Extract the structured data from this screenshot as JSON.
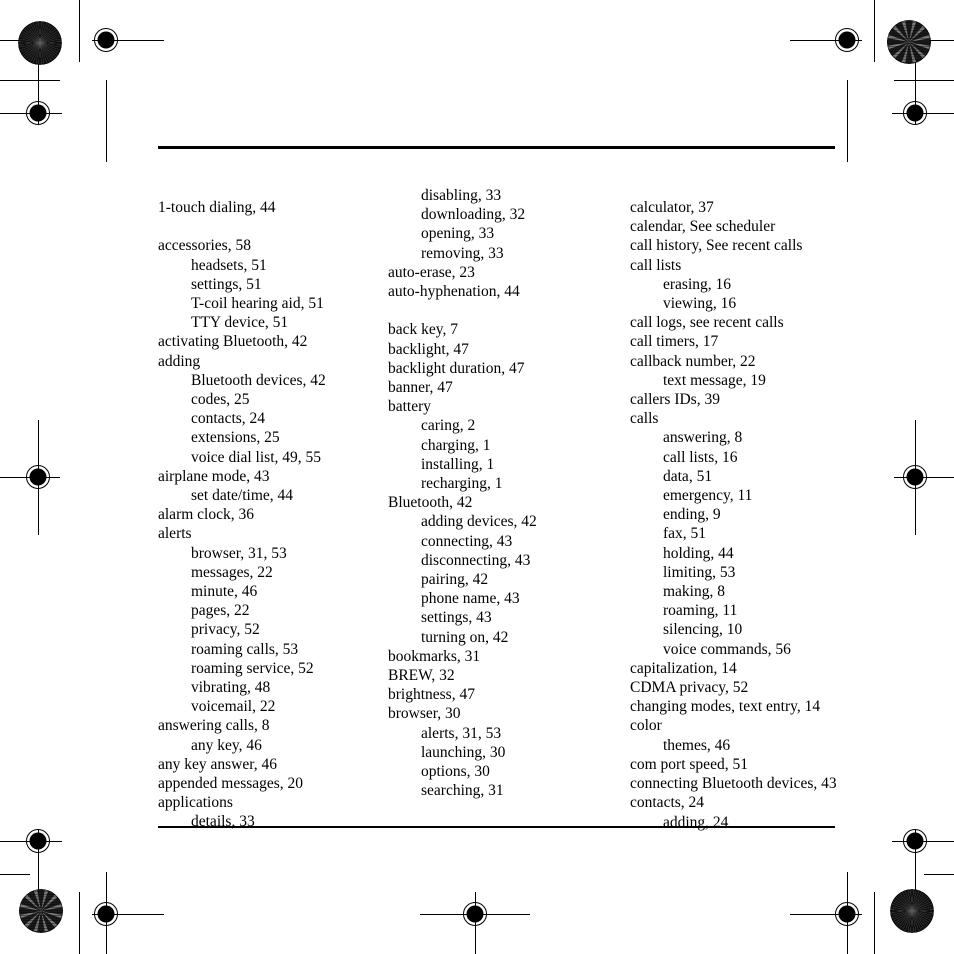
{
  "page": {
    "kind": "printed-index-page",
    "ink_color": "#000000",
    "paper_color": "#ffffff"
  },
  "rules": {
    "top_rule_label": "top-horizontal-rule",
    "bottom_rule_label": "bottom-horizontal-rule"
  },
  "printer_marks": {
    "registration_target_name": "registration-target",
    "star_target_name": "star-resolution-target",
    "crop_mark_name": "crop-mark"
  },
  "columns": [
    {
      "name": "index-column-1",
      "entries": [
        {
          "level": 1,
          "text": "1-touch dialing, 44"
        },
        {
          "level": 0,
          "text": ""
        },
        {
          "level": 1,
          "text": "accessories, 58"
        },
        {
          "level": 2,
          "text": "headsets, 51"
        },
        {
          "level": 2,
          "text": "settings, 51"
        },
        {
          "level": 2,
          "text": "T-coil hearing aid, 51"
        },
        {
          "level": 2,
          "text": "TTY device, 51"
        },
        {
          "level": 1,
          "text": "activating Bluetooth, 42"
        },
        {
          "level": 1,
          "text": "adding"
        },
        {
          "level": 2,
          "text": "Bluetooth devices, 42"
        },
        {
          "level": 2,
          "text": "codes, 25"
        },
        {
          "level": 2,
          "text": "contacts, 24"
        },
        {
          "level": 2,
          "text": "extensions, 25"
        },
        {
          "level": 2,
          "text": "voice dial list, 49, 55"
        },
        {
          "level": 1,
          "text": "airplane mode, 43"
        },
        {
          "level": 2,
          "text": "set date/time, 44"
        },
        {
          "level": 1,
          "text": "alarm clock, 36"
        },
        {
          "level": 1,
          "text": "alerts"
        },
        {
          "level": 2,
          "text": "browser, 31, 53"
        },
        {
          "level": 2,
          "text": "messages, 22"
        },
        {
          "level": 2,
          "text": "minute, 46"
        },
        {
          "level": 2,
          "text": "pages, 22"
        },
        {
          "level": 2,
          "text": "privacy, 52"
        },
        {
          "level": 2,
          "text": "roaming calls, 53"
        },
        {
          "level": 2,
          "text": "roaming service, 52"
        },
        {
          "level": 2,
          "text": "vibrating, 48"
        },
        {
          "level": 2,
          "text": "voicemail, 22"
        },
        {
          "level": 1,
          "text": "answering calls, 8"
        },
        {
          "level": 2,
          "text": "any key, 46"
        },
        {
          "level": 1,
          "text": "any key answer, 46"
        },
        {
          "level": 1,
          "text": "appended messages, 20"
        },
        {
          "level": 1,
          "text": "applications"
        },
        {
          "level": 2,
          "text": "details, 33"
        }
      ]
    },
    {
      "name": "index-column-2",
      "entries": [
        {
          "level": 2,
          "text": "disabling, 33"
        },
        {
          "level": 2,
          "text": "downloading, 32"
        },
        {
          "level": 2,
          "text": "opening, 33"
        },
        {
          "level": 2,
          "text": "removing, 33"
        },
        {
          "level": 1,
          "text": "auto-erase, 23"
        },
        {
          "level": 1,
          "text": "auto-hyphenation, 44"
        },
        {
          "level": 0,
          "text": ""
        },
        {
          "level": 1,
          "text": "back key, 7"
        },
        {
          "level": 1,
          "text": "backlight, 47"
        },
        {
          "level": 1,
          "text": "backlight duration, 47"
        },
        {
          "level": 1,
          "text": "banner, 47"
        },
        {
          "level": 1,
          "text": "battery"
        },
        {
          "level": 2,
          "text": "caring, 2"
        },
        {
          "level": 2,
          "text": "charging, 1"
        },
        {
          "level": 2,
          "text": "installing, 1"
        },
        {
          "level": 2,
          "text": "recharging, 1"
        },
        {
          "level": 1,
          "text": "Bluetooth, 42"
        },
        {
          "level": 2,
          "text": "adding devices, 42"
        },
        {
          "level": 2,
          "text": "connecting, 43"
        },
        {
          "level": 2,
          "text": "disconnecting, 43"
        },
        {
          "level": 2,
          "text": "pairing, 42"
        },
        {
          "level": 2,
          "text": "phone name, 43"
        },
        {
          "level": 2,
          "text": "settings, 43"
        },
        {
          "level": 2,
          "text": "turning on, 42"
        },
        {
          "level": 1,
          "text": "bookmarks, 31"
        },
        {
          "level": 1,
          "text": "BREW, 32"
        },
        {
          "level": 1,
          "text": "brightness, 47"
        },
        {
          "level": 1,
          "text": "browser, 30"
        },
        {
          "level": 2,
          "text": "alerts, 31, 53"
        },
        {
          "level": 2,
          "text": "launching, 30"
        },
        {
          "level": 2,
          "text": "options, 30"
        },
        {
          "level": 2,
          "text": "searching, 31"
        }
      ]
    },
    {
      "name": "index-column-3",
      "entries": [
        {
          "level": 1,
          "text": "calculator, 37"
        },
        {
          "level": 1,
          "text": "calendar, See scheduler"
        },
        {
          "level": 1,
          "text": "call history, See recent calls"
        },
        {
          "level": 1,
          "text": "call lists"
        },
        {
          "level": 2,
          "text": "erasing, 16"
        },
        {
          "level": 2,
          "text": "viewing, 16"
        },
        {
          "level": 1,
          "text": "call logs, see recent calls"
        },
        {
          "level": 1,
          "text": "call timers, 17"
        },
        {
          "level": 1,
          "text": "callback number, 22"
        },
        {
          "level": 2,
          "text": "text message, 19"
        },
        {
          "level": 1,
          "text": "callers IDs, 39"
        },
        {
          "level": 1,
          "text": "calls"
        },
        {
          "level": 2,
          "text": "answering, 8"
        },
        {
          "level": 2,
          "text": "call lists, 16"
        },
        {
          "level": 2,
          "text": "data, 51"
        },
        {
          "level": 2,
          "text": "emergency, 11"
        },
        {
          "level": 2,
          "text": "ending, 9"
        },
        {
          "level": 2,
          "text": "fax, 51"
        },
        {
          "level": 2,
          "text": "holding, 44"
        },
        {
          "level": 2,
          "text": "limiting, 53"
        },
        {
          "level": 2,
          "text": "making, 8"
        },
        {
          "level": 2,
          "text": "roaming, 11"
        },
        {
          "level": 2,
          "text": "silencing, 10"
        },
        {
          "level": 2,
          "text": "voice commands, 56"
        },
        {
          "level": 1,
          "text": "capitalization, 14"
        },
        {
          "level": 1,
          "text": "CDMA privacy, 52"
        },
        {
          "level": 1,
          "text": "changing modes, text entry, 14"
        },
        {
          "level": 1,
          "text": "color"
        },
        {
          "level": 2,
          "text": "themes, 46"
        },
        {
          "level": 1,
          "text": "com port speed, 51"
        },
        {
          "level": 1,
          "text": "connecting Bluetooth devices, 43"
        },
        {
          "level": 1,
          "text": "contacts, 24"
        },
        {
          "level": 2,
          "text": "adding, 24"
        }
      ]
    }
  ]
}
